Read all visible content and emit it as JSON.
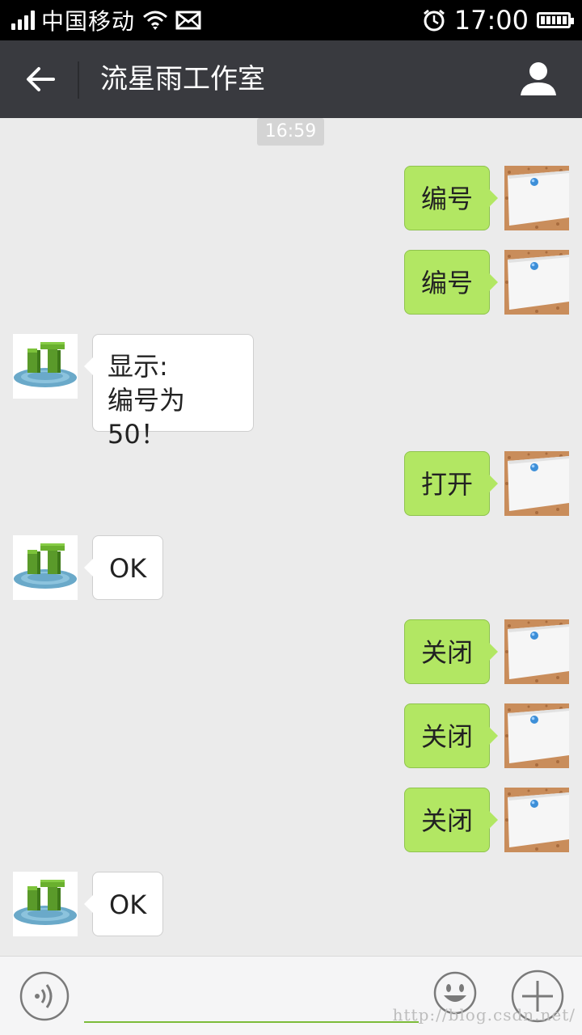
{
  "status_bar": {
    "carrier": "中国移动",
    "time": "17:00",
    "icons": [
      "signal-icon",
      "wifi-icon",
      "mail-icon",
      "alarm-icon",
      "battery-icon"
    ]
  },
  "title_bar": {
    "title": "流星雨工作室",
    "back_icon": "back-arrow-icon",
    "profile_icon": "profile-icon"
  },
  "chat": {
    "timestamp": "16:59",
    "messages": [
      {
        "side": "right",
        "text": "编号"
      },
      {
        "side": "right",
        "text": "编号"
      },
      {
        "side": "left",
        "lines": [
          "显示:",
          "编号为50！"
        ]
      },
      {
        "side": "right",
        "text": "打开"
      },
      {
        "side": "left",
        "text": "OK"
      },
      {
        "side": "right",
        "text": "关闭"
      },
      {
        "side": "right",
        "text": "关闭"
      },
      {
        "side": "right",
        "text": "关闭"
      },
      {
        "side": "left",
        "text": "OK"
      }
    ]
  },
  "input_bar": {
    "voice_icon": "voice-icon",
    "emoji_icon": "emoji-icon",
    "plus_icon": "plus-icon",
    "watermark": "http://blog.csdn.net/"
  },
  "colors": {
    "title_bar_bg": "#393a3f",
    "chat_bg": "#ebebeb",
    "outgoing_bubble": "#b2e763",
    "incoming_bubble": "#ffffff",
    "input_underline": "#7cbb3a"
  }
}
